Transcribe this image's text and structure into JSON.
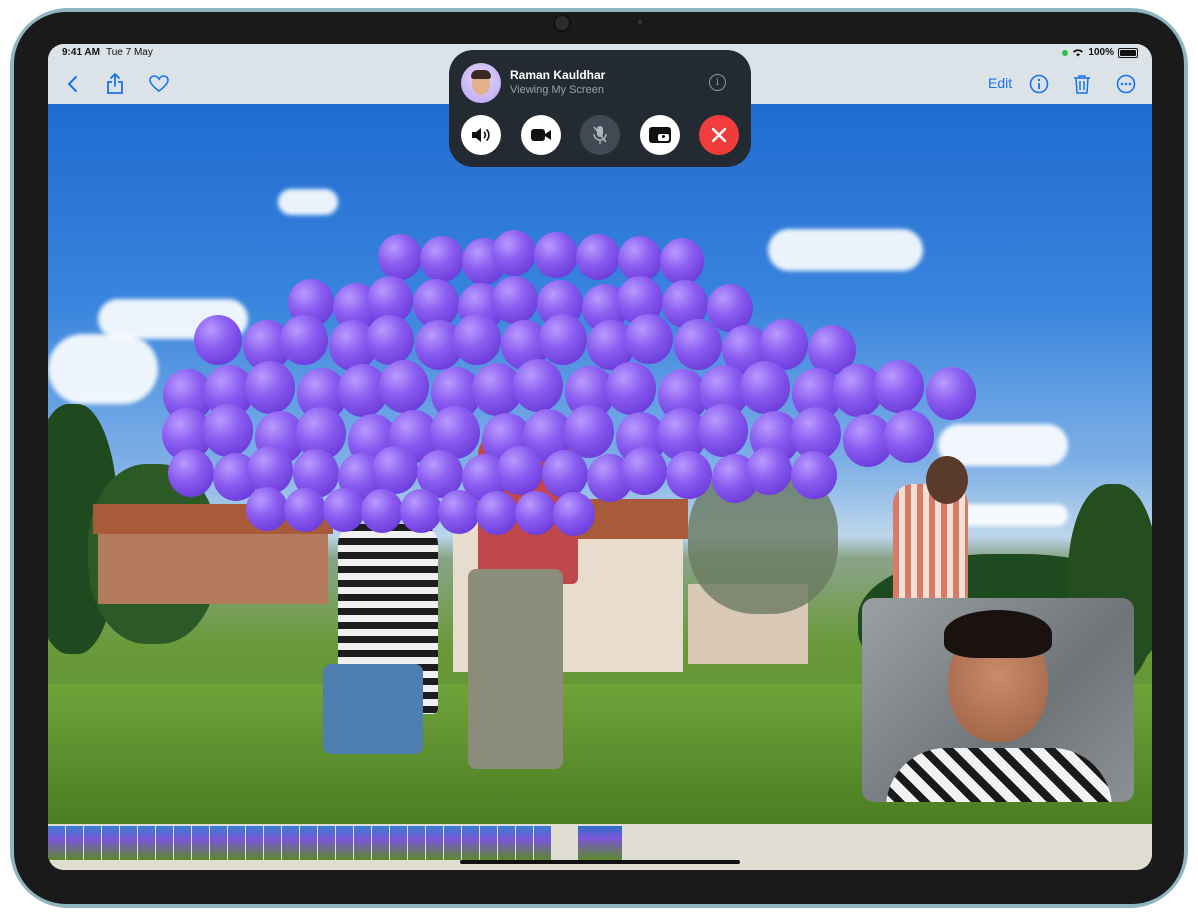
{
  "status_bar": {
    "time": "9:41 AM",
    "date": "Tue 7 May",
    "battery": "100%"
  },
  "toolbar": {
    "back_icon": "chevron-left-icon",
    "share_icon": "share-icon",
    "favorite_icon": "heart-icon",
    "edit_label": "Edit",
    "info_icon": "info-icon",
    "delete_icon": "trash-icon",
    "more_icon": "ellipsis-icon",
    "accent_color": "#1a73e8"
  },
  "facetime": {
    "caller_name": "Raman Kauldhar",
    "status": "Viewing My Screen",
    "controls": [
      {
        "name": "speaker-icon",
        "style": "white"
      },
      {
        "name": "video-camera-icon",
        "style": "white"
      },
      {
        "name": "mic-muted-icon",
        "style": "dark"
      },
      {
        "name": "screen-share-icon",
        "style": "white"
      },
      {
        "name": "end-call-icon",
        "style": "red"
      }
    ],
    "end_call_color": "#f03c3c"
  }
}
